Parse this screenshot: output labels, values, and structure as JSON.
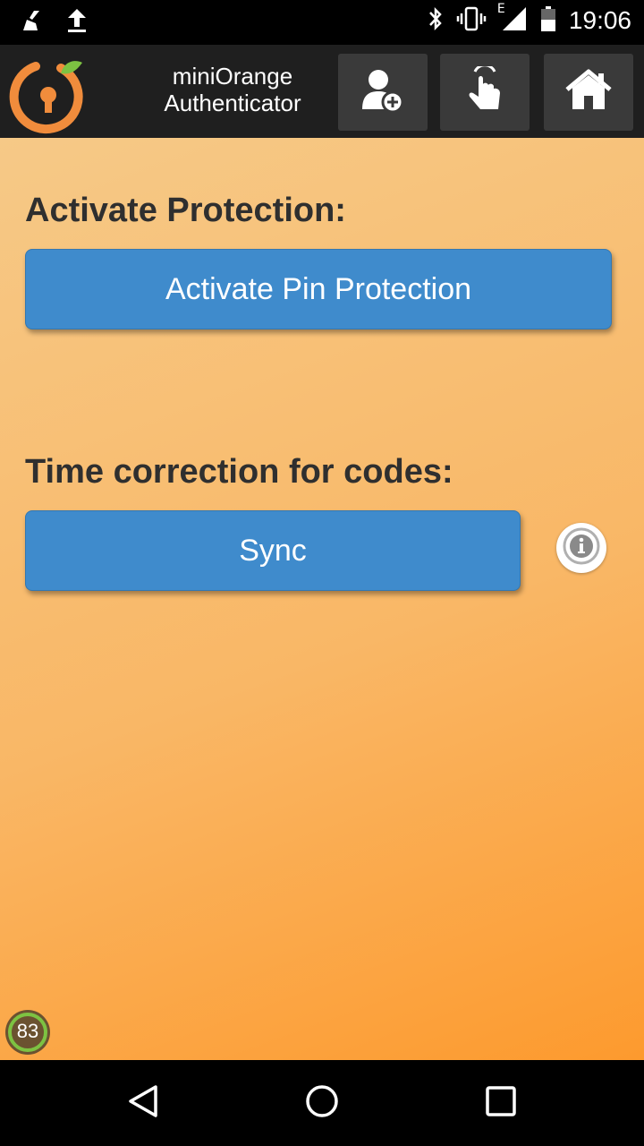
{
  "status_bar": {
    "time": "19:06",
    "network_type": "E",
    "icons": [
      "broom-icon",
      "upload-icon",
      "bluetooth-icon",
      "vibrate-icon",
      "signal-icon",
      "battery-icon"
    ]
  },
  "app_bar": {
    "title_line1": "miniOrange",
    "title_line2": "Authenticator",
    "buttons": [
      "add-user-icon",
      "touch-icon",
      "home-icon"
    ]
  },
  "main": {
    "protection_label": "Activate Protection:",
    "activate_pin_label": "Activate Pin Protection",
    "time_correction_label": "Time correction for codes:",
    "sync_label": "Sync",
    "info_icon": "info-icon"
  },
  "badge": {
    "value": "83"
  },
  "colors": {
    "accent_blue": "#3f8bcc",
    "orange_light": "#f6c987",
    "orange_dark": "#fd9a2e",
    "appbar": "#1f1f1f",
    "logo_orange": "#f08c3c",
    "badge_green": "#7dc242"
  },
  "nav_bar": {
    "icons": [
      "back-icon",
      "home-circle-icon",
      "recents-icon"
    ]
  }
}
